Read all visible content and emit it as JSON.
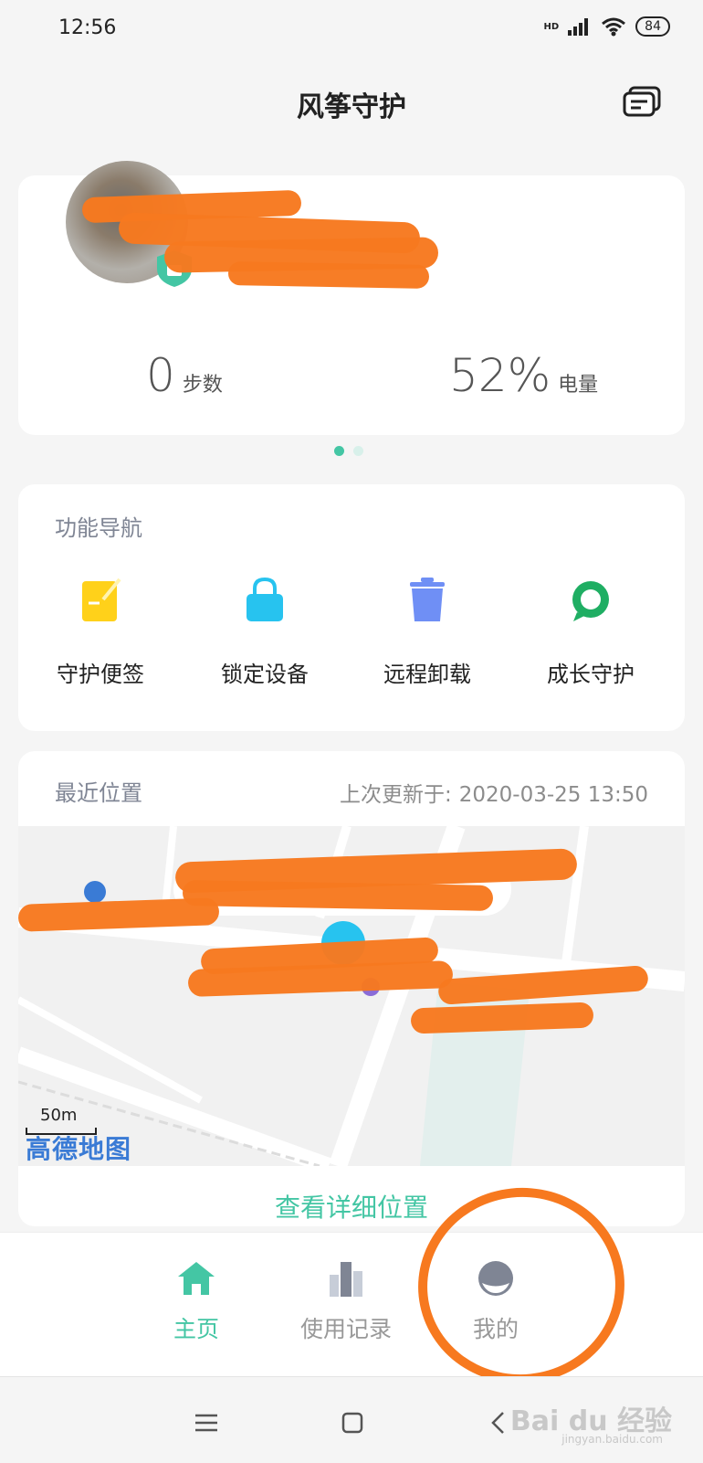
{
  "status_bar": {
    "time": "12:56",
    "network": "HD",
    "battery": "84"
  },
  "header": {
    "title": "风筝守护",
    "message_icon": "message-list-icon"
  },
  "profile": {
    "steps_value": "0",
    "steps_label": "步数",
    "battery_value": "52%",
    "battery_label": "电量"
  },
  "pager": {
    "count": 2,
    "active_index": 0
  },
  "functions": {
    "title": "功能导航",
    "items": [
      {
        "label": "守护便签",
        "icon": "note-icon",
        "color": "#ffd11a"
      },
      {
        "label": "锁定设备",
        "icon": "lock-icon",
        "color": "#27c3ef"
      },
      {
        "label": "远程卸载",
        "icon": "trash-icon",
        "color": "#6f8ff5"
      },
      {
        "label": "成长守护",
        "icon": "chat-ring-icon",
        "color": "#1fae63"
      }
    ]
  },
  "location": {
    "title": "最近位置",
    "updated_label": "上次更新于:",
    "updated_time": "2020-03-25 13:50",
    "scale": "50m",
    "map_provider": "高德地图",
    "detail_link": "查看详细位置"
  },
  "tabs": [
    {
      "label": "主页",
      "icon": "home-icon",
      "active": true
    },
    {
      "label": "使用记录",
      "icon": "bar-chart-icon",
      "active": false
    },
    {
      "label": "我的",
      "icon": "profile-icon",
      "active": false
    }
  ],
  "watermark": {
    "text": "Bai du 经验",
    "sub": "jingyan.baidu.com"
  },
  "colors": {
    "accent": "#44c6a4",
    "annotation": "#f7791f"
  }
}
